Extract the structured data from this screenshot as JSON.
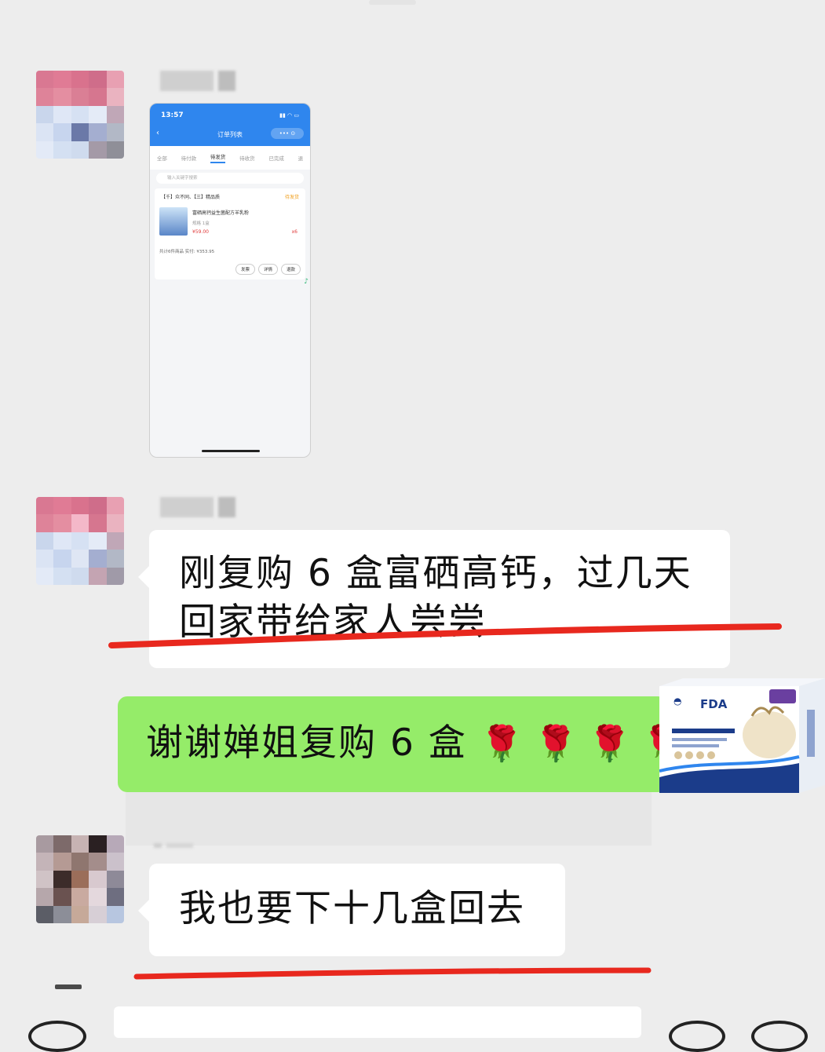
{
  "messages": [
    {
      "id": "m1",
      "kind": "image",
      "sender": "other"
    },
    {
      "id": "m2",
      "kind": "text",
      "sender": "other",
      "lines": [
        "刚复购 6 盒富硒高钙，过几天",
        "回家带给家人尝尝"
      ]
    },
    {
      "id": "m3",
      "kind": "text",
      "sender": "self",
      "text": "谢谢婵姐复购 6 盒",
      "emoji": "🌹🌹🌹🌹"
    },
    {
      "id": "m4",
      "kind": "text",
      "sender": "other",
      "text": "我也要下十几盒回去"
    }
  ],
  "screenshot": {
    "time": "13:57",
    "title": "订单列表",
    "capsule": "••• ⊙",
    "tabs": [
      "全部",
      "待付款",
      "待发货",
      "待收货",
      "已完成",
      "退"
    ],
    "active_tab": "待发货",
    "search_placeholder": "输入关键字搜索",
    "shop": "【千】众不同、【三】精品质",
    "status": "待发货",
    "product_name": "富硒高钙益生菌配方羊乳粉",
    "spec": "规格 1盒",
    "price": "¥59.00",
    "qty": "x6",
    "total": "共计6件商品 实付: ¥353.95",
    "buttons": [
      "发票",
      "详情",
      "退款"
    ]
  },
  "product_image": {
    "brand": "FDA"
  },
  "colors": {
    "background": "#ededed",
    "bubble_other": "#ffffff",
    "bubble_self": "#95ec69",
    "underline": "#e8281e",
    "app_blue": "#2f86ee"
  }
}
